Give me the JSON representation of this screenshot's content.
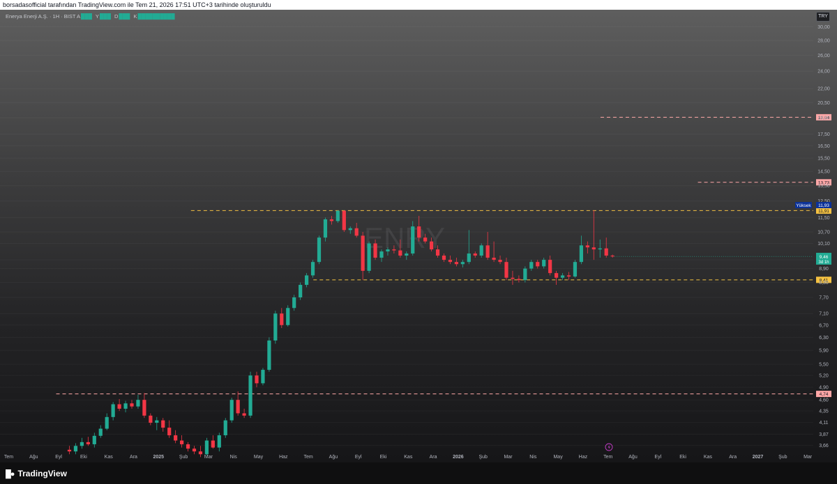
{
  "header": {
    "attribution": "borsadasofficial tarafından TradingView.com ile Tem 21, 2026 17:51 UTC+3 tarihinde oluşturuldu"
  },
  "legend": {
    "symbol": "Enerya Enerji A.Ş. · 1H · BIST",
    "o_label": "A",
    "h_label": "Y",
    "l_label": "D",
    "c_label": "K",
    "values_obscured": true
  },
  "currency_badge": "TRY",
  "watermark": "ENRY",
  "price_badges": {
    "high_label": "Yüksek",
    "high_value": "11,93",
    "current_value": "9,46",
    "countdown": "3d 1h"
  },
  "footer": {
    "brand": "TradingView"
  },
  "colors": {
    "up": "#22ab94",
    "down": "#f23645",
    "red_dash": "#ffa7a7",
    "yellow_dash": "#f5c242",
    "high_badge": "#0c3299",
    "current_badge": "#22ab94"
  },
  "chart_data": {
    "type": "candlestick",
    "y_scale": "log",
    "y_ticks": [
      30,
      28,
      26,
      24,
      22,
      20.5,
      19,
      17.5,
      16.5,
      15.5,
      14.5,
      13.5,
      12.5,
      11.5,
      10.7,
      10.1,
      9.3,
      8.9,
      8.3,
      7.7,
      7.1,
      6.7,
      6.3,
      5.9,
      5.5,
      5.2,
      4.9,
      4.6,
      4.35,
      4.11,
      3.87,
      3.66
    ],
    "y_tick_labels": [
      "30,00",
      "28,00",
      "26,00",
      "24,00",
      "22,00",
      "20,50",
      "19,00",
      "17,50",
      "16,50",
      "15,50",
      "14,50",
      "13,50",
      "12,50",
      "11,50",
      "10,70",
      "10,10",
      "9,30",
      "8,90",
      "8,30",
      "7,70",
      "7,10",
      "6,70",
      "6,30",
      "5,90",
      "5,50",
      "5,20",
      "4,90",
      "4,60",
      "4,35",
      "4,11",
      "3,87",
      "3,66"
    ],
    "x_ticks": [
      "Tem",
      "Ağu",
      "Eyl",
      "Eki",
      "Kas",
      "Ara",
      "2025",
      "Şub",
      "Mar",
      "Nis",
      "May",
      "Haz",
      "Tem",
      "Ağu",
      "Eyl",
      "Eki",
      "Kas",
      "Ara",
      "2026",
      "Şub",
      "Mar",
      "Nis",
      "May",
      "Haz",
      "Tem",
      "Ağu",
      "Eyl",
      "Eki",
      "Kas",
      "Ara",
      "2027",
      "Şub",
      "Mar"
    ],
    "x_ticks_bold": [
      "2025",
      "2026",
      "2027"
    ],
    "levels": [
      {
        "price": 19.04,
        "label": "19,04",
        "style": "red",
        "from_tick": 23.7
      },
      {
        "price": 13.73,
        "label": "13,73",
        "style": "red",
        "from_tick": 27.6
      },
      {
        "price": 11.91,
        "label": "11,91",
        "style": "yellow",
        "from_tick": 7.3
      },
      {
        "price": 8.41,
        "label": "8,41",
        "style": "yellow",
        "from_tick": 12.2
      },
      {
        "price": 4.74,
        "label": "4,74",
        "style": "red",
        "from_tick": 1.9
      }
    ],
    "current_price": 9.46,
    "candles": [
      {
        "o": 3.58,
        "h": 3.65,
        "l": 3.5,
        "c": 3.55
      },
      {
        "o": 3.55,
        "h": 3.7,
        "l": 3.5,
        "c": 3.65
      },
      {
        "o": 3.65,
        "h": 3.8,
        "l": 3.6,
        "c": 3.72
      },
      {
        "o": 3.72,
        "h": 3.82,
        "l": 3.65,
        "c": 3.68
      },
      {
        "o": 3.68,
        "h": 3.9,
        "l": 3.62,
        "c": 3.84
      },
      {
        "o": 3.84,
        "h": 4.05,
        "l": 3.8,
        "c": 3.98
      },
      {
        "o": 3.98,
        "h": 4.3,
        "l": 3.95,
        "c": 4.22
      },
      {
        "o": 4.22,
        "h": 4.55,
        "l": 4.15,
        "c": 4.5
      },
      {
        "o": 4.5,
        "h": 4.62,
        "l": 4.35,
        "c": 4.4
      },
      {
        "o": 4.4,
        "h": 4.58,
        "l": 4.32,
        "c": 4.52
      },
      {
        "o": 4.52,
        "h": 4.6,
        "l": 4.4,
        "c": 4.45
      },
      {
        "o": 4.45,
        "h": 4.72,
        "l": 4.4,
        "c": 4.6
      },
      {
        "o": 4.6,
        "h": 4.76,
        "l": 4.2,
        "c": 4.25
      },
      {
        "o": 4.25,
        "h": 4.3,
        "l": 4.05,
        "c": 4.1
      },
      {
        "o": 4.1,
        "h": 4.22,
        "l": 3.95,
        "c": 4.15
      },
      {
        "o": 4.15,
        "h": 4.2,
        "l": 3.92,
        "c": 4.0
      },
      {
        "o": 4.0,
        "h": 4.15,
        "l": 3.8,
        "c": 3.85
      },
      {
        "o": 3.85,
        "h": 3.95,
        "l": 3.7,
        "c": 3.75
      },
      {
        "o": 3.75,
        "h": 3.85,
        "l": 3.62,
        "c": 3.68
      },
      {
        "o": 3.68,
        "h": 3.72,
        "l": 3.55,
        "c": 3.6
      },
      {
        "o": 3.6,
        "h": 3.65,
        "l": 3.5,
        "c": 3.55
      },
      {
        "o": 3.55,
        "h": 3.65,
        "l": 3.45,
        "c": 3.5
      },
      {
        "o": 3.5,
        "h": 3.8,
        "l": 3.48,
        "c": 3.75
      },
      {
        "o": 3.75,
        "h": 3.85,
        "l": 3.6,
        "c": 3.62
      },
      {
        "o": 3.62,
        "h": 3.9,
        "l": 3.55,
        "c": 3.85
      },
      {
        "o": 3.85,
        "h": 4.2,
        "l": 3.8,
        "c": 4.15
      },
      {
        "o": 4.15,
        "h": 4.65,
        "l": 4.1,
        "c": 4.6
      },
      {
        "o": 4.6,
        "h": 4.8,
        "l": 4.25,
        "c": 4.3
      },
      {
        "o": 4.3,
        "h": 4.4,
        "l": 4.2,
        "c": 4.25
      },
      {
        "o": 4.25,
        "h": 5.3,
        "l": 4.2,
        "c": 5.2
      },
      {
        "o": 5.2,
        "h": 5.3,
        "l": 4.9,
        "c": 5.0
      },
      {
        "o": 5.0,
        "h": 5.4,
        "l": 4.95,
        "c": 5.35
      },
      {
        "o": 5.35,
        "h": 6.3,
        "l": 5.3,
        "c": 6.2
      },
      {
        "o": 6.2,
        "h": 7.2,
        "l": 6.1,
        "c": 7.1
      },
      {
        "o": 7.1,
        "h": 7.3,
        "l": 6.6,
        "c": 6.7
      },
      {
        "o": 6.7,
        "h": 7.4,
        "l": 6.65,
        "c": 7.3
      },
      {
        "o": 7.3,
        "h": 7.8,
        "l": 7.2,
        "c": 7.7
      },
      {
        "o": 7.7,
        "h": 8.3,
        "l": 7.6,
        "c": 8.2
      },
      {
        "o": 8.2,
        "h": 8.7,
        "l": 8.1,
        "c": 8.6
      },
      {
        "o": 8.6,
        "h": 9.3,
        "l": 8.5,
        "c": 9.2
      },
      {
        "o": 9.2,
        "h": 10.5,
        "l": 9.1,
        "c": 10.4
      },
      {
        "o": 10.4,
        "h": 11.5,
        "l": 10.2,
        "c": 11.4
      },
      {
        "o": 11.4,
        "h": 11.6,
        "l": 11.1,
        "c": 11.3
      },
      {
        "o": 11.3,
        "h": 11.93,
        "l": 11.2,
        "c": 11.9
      },
      {
        "o": 11.9,
        "h": 11.93,
        "l": 10.7,
        "c": 10.8
      },
      {
        "o": 10.8,
        "h": 11.0,
        "l": 10.6,
        "c": 10.9
      },
      {
        "o": 10.9,
        "h": 11.2,
        "l": 10.4,
        "c": 10.5
      },
      {
        "o": 10.5,
        "h": 10.7,
        "l": 8.4,
        "c": 8.8
      },
      {
        "o": 8.8,
        "h": 10.2,
        "l": 8.7,
        "c": 10.1
      },
      {
        "o": 10.1,
        "h": 10.3,
        "l": 9.3,
        "c": 9.4
      },
      {
        "o": 9.4,
        "h": 9.8,
        "l": 9.2,
        "c": 9.7
      },
      {
        "o": 9.7,
        "h": 9.9,
        "l": 9.5,
        "c": 9.8
      },
      {
        "o": 9.8,
        "h": 10.0,
        "l": 9.6,
        "c": 9.75
      },
      {
        "o": 9.75,
        "h": 10.3,
        "l": 9.4,
        "c": 9.5
      },
      {
        "o": 9.5,
        "h": 9.7,
        "l": 9.3,
        "c": 9.6
      },
      {
        "o": 9.6,
        "h": 11.3,
        "l": 9.5,
        "c": 11.0
      },
      {
        "o": 11.0,
        "h": 11.6,
        "l": 10.2,
        "c": 10.4
      },
      {
        "o": 10.4,
        "h": 10.6,
        "l": 10.1,
        "c": 10.2
      },
      {
        "o": 10.2,
        "h": 10.4,
        "l": 9.7,
        "c": 9.8
      },
      {
        "o": 9.8,
        "h": 10.0,
        "l": 9.4,
        "c": 9.5
      },
      {
        "o": 9.5,
        "h": 9.6,
        "l": 9.2,
        "c": 9.3
      },
      {
        "o": 9.3,
        "h": 9.5,
        "l": 9.1,
        "c": 9.2
      },
      {
        "o": 9.2,
        "h": 9.4,
        "l": 9.0,
        "c": 9.1
      },
      {
        "o": 9.1,
        "h": 9.3,
        "l": 8.95,
        "c": 9.2
      },
      {
        "o": 9.2,
        "h": 10.8,
        "l": 9.1,
        "c": 9.6
      },
      {
        "o": 9.6,
        "h": 9.7,
        "l": 9.4,
        "c": 9.5
      },
      {
        "o": 9.5,
        "h": 10.1,
        "l": 9.4,
        "c": 10.0
      },
      {
        "o": 10.0,
        "h": 10.7,
        "l": 9.3,
        "c": 9.4
      },
      {
        "o": 9.4,
        "h": 10.2,
        "l": 9.2,
        "c": 9.3
      },
      {
        "o": 9.3,
        "h": 9.5,
        "l": 9.1,
        "c": 9.2
      },
      {
        "o": 9.2,
        "h": 9.4,
        "l": 8.4,
        "c": 8.5
      },
      {
        "o": 8.5,
        "h": 8.8,
        "l": 8.2,
        "c": 8.45
      },
      {
        "o": 8.45,
        "h": 8.6,
        "l": 8.3,
        "c": 8.4
      },
      {
        "o": 8.4,
        "h": 9.0,
        "l": 8.3,
        "c": 8.9
      },
      {
        "o": 8.9,
        "h": 9.3,
        "l": 8.8,
        "c": 9.2
      },
      {
        "o": 9.2,
        "h": 9.3,
        "l": 8.9,
        "c": 9.0
      },
      {
        "o": 9.0,
        "h": 9.4,
        "l": 8.9,
        "c": 9.3
      },
      {
        "o": 9.3,
        "h": 9.5,
        "l": 8.6,
        "c": 8.7
      },
      {
        "o": 8.7,
        "h": 8.8,
        "l": 8.2,
        "c": 8.5
      },
      {
        "o": 8.5,
        "h": 8.7,
        "l": 8.4,
        "c": 8.6
      },
      {
        "o": 8.6,
        "h": 8.75,
        "l": 8.4,
        "c": 8.55
      },
      {
        "o": 8.55,
        "h": 9.3,
        "l": 8.5,
        "c": 9.2
      },
      {
        "o": 9.2,
        "h": 10.5,
        "l": 9.1,
        "c": 10.0
      },
      {
        "o": 10.0,
        "h": 10.2,
        "l": 9.6,
        "c": 9.9
      },
      {
        "o": 9.9,
        "h": 11.93,
        "l": 9.3,
        "c": 9.8
      },
      {
        "o": 9.8,
        "h": 10.3,
        "l": 9.4,
        "c": 9.85
      },
      {
        "o": 9.85,
        "h": 10.4,
        "l": 9.4,
        "c": 9.5
      },
      {
        "o": 9.5,
        "h": 9.55,
        "l": 9.4,
        "c": 9.46
      }
    ]
  }
}
